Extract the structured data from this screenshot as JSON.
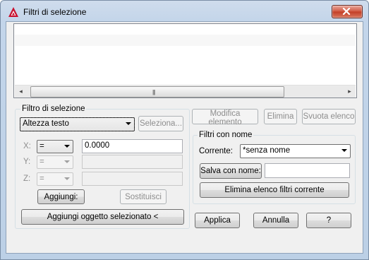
{
  "window": {
    "title": "Filtri di selezione",
    "close_glyph": "✕"
  },
  "listbox": {
    "scroll_left": "◂",
    "scroll_right": "▸",
    "grip": "|||"
  },
  "selection_filter": {
    "group_label": "Filtro di selezione",
    "filter_type": "Altezza testo",
    "select_button": "Seleziona...",
    "x_label": "X:",
    "y_label": "Y:",
    "z_label": "Z:",
    "x_operator": "=",
    "y_operator": "=",
    "z_operator": "=",
    "x_value": "0.0000",
    "add_button": "Aggiungi:",
    "replace_button": "Sostituisci",
    "add_selected_object_button": "Aggiungi oggetto selezionato <"
  },
  "list_actions": {
    "edit_item_button": "Modifica elemento",
    "delete_button": "Elimina",
    "clear_list_button": "Svuota elenco"
  },
  "named_filters": {
    "group_label": "Filtri con nome",
    "current_label": "Corrente:",
    "current_value": "*senza nome",
    "save_as_button": "Salva con nome:",
    "save_as_value": "",
    "delete_current_button": "Elimina elenco filtri corrente"
  },
  "footer": {
    "apply_button": "Applica",
    "cancel_button": "Annulla",
    "help_button": "?"
  }
}
